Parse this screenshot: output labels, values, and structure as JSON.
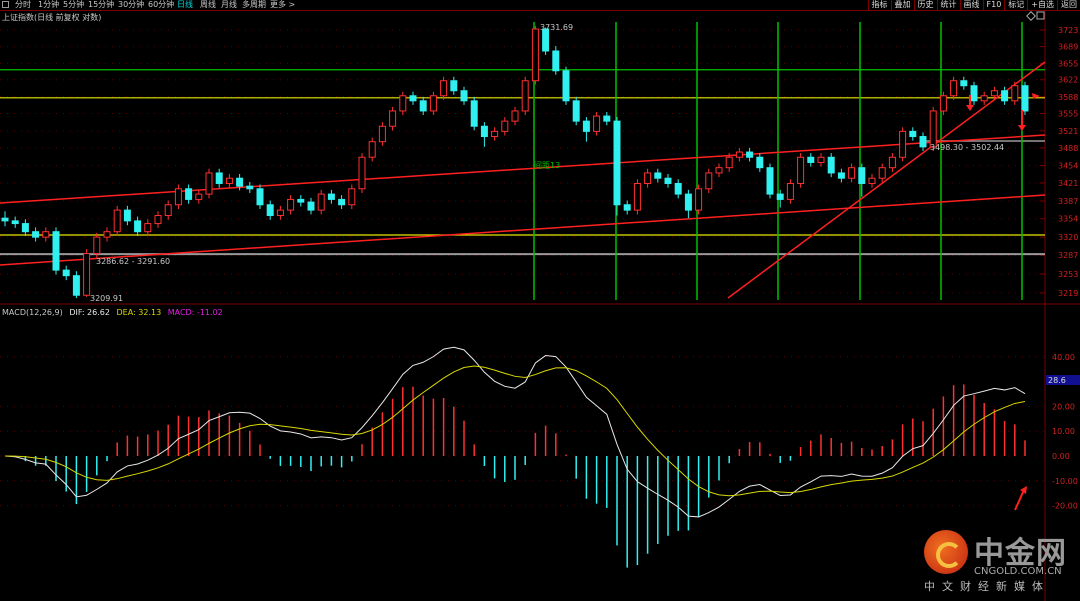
{
  "toolbar": {
    "tabs": [
      "分时",
      "1分钟",
      "5分钟",
      "15分钟",
      "30分钟",
      "60分钟",
      "日线",
      "周线",
      "月线",
      "多周期",
      "更多 >"
    ],
    "active": "日线",
    "right_buttons": [
      "指标",
      "叠加",
      "历史",
      "统计",
      "画线",
      "F10",
      "标记",
      "+自选",
      "返回"
    ]
  },
  "title": "上证指数(日线 前复权 对数)",
  "macd": {
    "name": "MACD(12,26,9)",
    "dif": "DIF: 26.62",
    "dea": "DEA: 32.13",
    "macd": "MACD: -11.02",
    "current_tag": "28.6"
  },
  "colors": {
    "up": "#ff3030",
    "down": "#30f0f0",
    "dif": "#e8e8e8",
    "dea": "#d8d800",
    "macd_label": "#e020e0",
    "grid": "#7a0000",
    "vline": "#00c000"
  },
  "logo": {
    "cn": "中金网",
    "url": "CNGOLD.COM.CN",
    "sub": "中文财经新媒体"
  },
  "chart_data": {
    "type": "candlestick",
    "price_scale": "log",
    "ylim": [
      3219,
      3723
    ],
    "ytick_labels": [
      "3723",
      "3689",
      "3655",
      "3622",
      "3588",
      "3555",
      "3521",
      "3488",
      "3454",
      "3421",
      "3387",
      "3354",
      "3320",
      "3287",
      "3253",
      "3219"
    ],
    "macd_ytick_labels": [
      "40.00",
      "20.00",
      "10.00",
      "0.00",
      "-10.00",
      "-20.00"
    ],
    "macd_ylim": [
      -25,
      45
    ],
    "annotations": [
      "3731.69",
      "3286.62 - 3291.60",
      "3209.91",
      "3498.30 - 3502.44",
      "间距13"
    ],
    "horizontal_lines": [
      {
        "price": 3642,
        "color": "#00c000"
      },
      {
        "price": 3586,
        "color": "#e8e800"
      },
      {
        "price": 3324,
        "color": "#e8e800"
      },
      {
        "price": 3289,
        "color": "#999999"
      }
    ],
    "ohlc": [
      [
        3355,
        3368,
        3340,
        3350
      ],
      [
        3350,
        3358,
        3337,
        3345
      ],
      [
        3345,
        3353,
        3322,
        3330
      ],
      [
        3330,
        3338,
        3312,
        3320
      ],
      [
        3320,
        3338,
        3312,
        3330
      ],
      [
        3330,
        3338,
        3252,
        3260
      ],
      [
        3260,
        3268,
        3242,
        3250
      ],
      [
        3250,
        3258,
        3209.91,
        3215
      ],
      [
        3215,
        3298,
        3212,
        3290
      ],
      [
        3290,
        3328,
        3282,
        3320
      ],
      [
        3320,
        3338,
        3312,
        3330
      ],
      [
        3330,
        3378,
        3322,
        3370
      ],
      [
        3370,
        3378,
        3342,
        3350
      ],
      [
        3350,
        3358,
        3322,
        3330
      ],
      [
        3330,
        3353,
        3322,
        3345
      ],
      [
        3345,
        3368,
        3337,
        3360
      ],
      [
        3360,
        3388,
        3352,
        3380
      ],
      [
        3380,
        3418,
        3372,
        3410
      ],
      [
        3410,
        3418,
        3382,
        3390
      ],
      [
        3390,
        3408,
        3382,
        3400
      ],
      [
        3400,
        3448,
        3392,
        3440
      ],
      [
        3440,
        3448,
        3412,
        3420
      ],
      [
        3420,
        3438,
        3412,
        3430
      ],
      [
        3430,
        3438,
        3407,
        3415
      ],
      [
        3415,
        3423,
        3402,
        3410
      ],
      [
        3410,
        3418,
        3372,
        3380
      ],
      [
        3380,
        3388,
        3352,
        3360
      ],
      [
        3360,
        3378,
        3352,
        3370
      ],
      [
        3370,
        3398,
        3362,
        3390
      ],
      [
        3390,
        3398,
        3377,
        3385
      ],
      [
        3385,
        3393,
        3362,
        3370
      ],
      [
        3370,
        3408,
        3362,
        3400
      ],
      [
        3400,
        3408,
        3382,
        3390
      ],
      [
        3390,
        3398,
        3372,
        3380
      ],
      [
        3380,
        3418,
        3372,
        3410
      ],
      [
        3410,
        3478,
        3402,
        3470
      ],
      [
        3470,
        3508,
        3462,
        3500
      ],
      [
        3500,
        3538,
        3492,
        3530
      ],
      [
        3530,
        3568,
        3522,
        3560
      ],
      [
        3560,
        3598,
        3552,
        3590
      ],
      [
        3590,
        3598,
        3572,
        3580
      ],
      [
        3580,
        3588,
        3552,
        3560
      ],
      [
        3560,
        3598,
        3552,
        3590
      ],
      [
        3590,
        3628,
        3582,
        3620
      ],
      [
        3620,
        3628,
        3592,
        3600
      ],
      [
        3600,
        3608,
        3572,
        3580
      ],
      [
        3580,
        3588,
        3522,
        3530
      ],
      [
        3530,
        3538,
        3490,
        3510
      ],
      [
        3510,
        3528,
        3502,
        3520
      ],
      [
        3520,
        3548,
        3512,
        3540
      ],
      [
        3540,
        3568,
        3532,
        3560
      ],
      [
        3560,
        3628,
        3552,
        3620
      ],
      [
        3620,
        3731.69,
        3612,
        3725
      ],
      [
        3725,
        3728,
        3672,
        3680
      ],
      [
        3680,
        3690,
        3632,
        3640
      ],
      [
        3640,
        3648,
        3572,
        3580
      ],
      [
        3580,
        3588,
        3532,
        3540
      ],
      [
        3540,
        3548,
        3500,
        3520
      ],
      [
        3520,
        3558,
        3512,
        3550
      ],
      [
        3550,
        3558,
        3532,
        3540
      ],
      [
        3540,
        3548,
        3360,
        3380
      ],
      [
        3380,
        3388,
        3362,
        3370
      ],
      [
        3370,
        3428,
        3362,
        3420
      ],
      [
        3420,
        3448,
        3412,
        3440
      ],
      [
        3440,
        3448,
        3422,
        3430
      ],
      [
        3430,
        3438,
        3412,
        3420
      ],
      [
        3420,
        3428,
        3392,
        3400
      ],
      [
        3400,
        3408,
        3355,
        3370
      ],
      [
        3370,
        3418,
        3362,
        3410
      ],
      [
        3410,
        3448,
        3402,
        3440
      ],
      [
        3440,
        3458,
        3432,
        3450
      ],
      [
        3450,
        3478,
        3442,
        3470
      ],
      [
        3470,
        3488,
        3462,
        3480
      ],
      [
        3480,
        3488,
        3462,
        3470
      ],
      [
        3470,
        3478,
        3442,
        3450
      ],
      [
        3450,
        3458,
        3392,
        3400
      ],
      [
        3400,
        3408,
        3375,
        3390
      ],
      [
        3390,
        3428,
        3382,
        3420
      ],
      [
        3420,
        3478,
        3412,
        3470
      ],
      [
        3470,
        3478,
        3452,
        3460
      ],
      [
        3460,
        3478,
        3452,
        3470
      ],
      [
        3470,
        3478,
        3432,
        3440
      ],
      [
        3440,
        3448,
        3422,
        3430
      ],
      [
        3430,
        3458,
        3422,
        3450
      ],
      [
        3450,
        3458,
        3395,
        3420
      ],
      [
        3420,
        3438,
        3412,
        3430
      ],
      [
        3430,
        3458,
        3422,
        3450
      ],
      [
        3450,
        3478,
        3442,
        3470
      ],
      [
        3470,
        3528,
        3462,
        3520
      ],
      [
        3520,
        3528,
        3502,
        3510
      ],
      [
        3510,
        3518,
        3482,
        3490
      ],
      [
        3490,
        3568,
        3482,
        3560
      ],
      [
        3560,
        3598,
        3552,
        3590
      ],
      [
        3590,
        3628,
        3582,
        3620
      ],
      [
        3620,
        3628,
        3602,
        3610
      ],
      [
        3610,
        3618,
        3572,
        3580
      ],
      [
        3580,
        3598,
        3572,
        3590
      ],
      [
        3590,
        3608,
        3582,
        3600
      ],
      [
        3600,
        3608,
        3572,
        3580
      ],
      [
        3580,
        3618,
        3572,
        3610
      ],
      [
        3610,
        3618,
        3552,
        3560
      ]
    ]
  }
}
